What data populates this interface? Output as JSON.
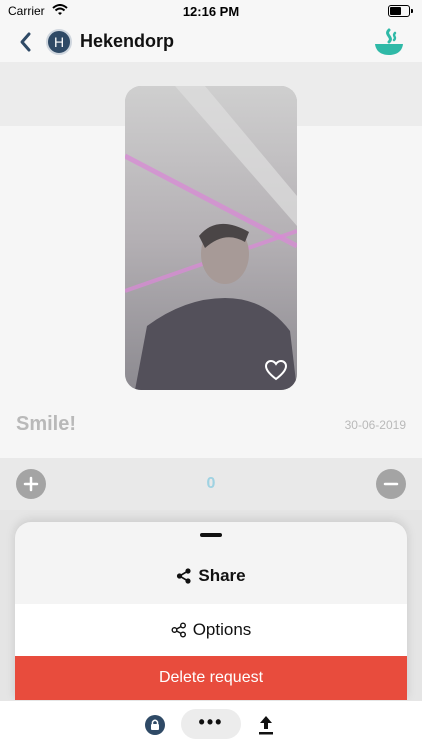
{
  "status_bar": {
    "carrier": "Carrier",
    "time": "12:16 PM",
    "battery_percent": 60
  },
  "header": {
    "title": "Hekendorp",
    "avatar_letter": "H"
  },
  "post": {
    "caption": "Smile!",
    "date": "30-06-2019",
    "count": "0"
  },
  "sheet": {
    "share_label": "Share",
    "options_label": "Options",
    "delete_label": "Delete request"
  },
  "toolbar": {
    "more_label": "•••"
  },
  "colors": {
    "accent": "#2fb9a7",
    "danger": "#e84c3d",
    "navy": "#2f4a66",
    "count": "#9fd2e2"
  },
  "icons": [
    "chevron-left-icon",
    "wifi-icon",
    "battery-icon",
    "bowl-logo-icon",
    "heart-icon",
    "plus-icon",
    "minus-icon",
    "share-icon",
    "options-icon",
    "lock-icon",
    "more-icon",
    "upload-icon"
  ]
}
